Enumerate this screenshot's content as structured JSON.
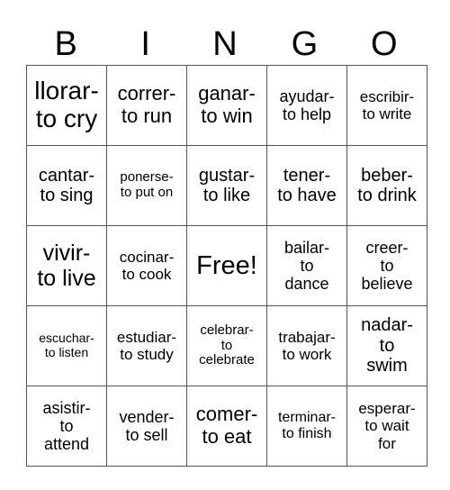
{
  "header": [
    "B",
    "I",
    "N",
    "G",
    "O"
  ],
  "rows": [
    [
      "llorar-\nto cry",
      "correr-\nto run",
      "ganar-\nto win",
      "ayudar-\nto help",
      "escribir-\nto write"
    ],
    [
      "cantar-\nto sing",
      "ponerse-\nto put on",
      "gustar-\nto like",
      "tener-\nto have",
      "beber-\nto drink"
    ],
    [
      "vivir-\nto live",
      "cocinar-\nto cook",
      "Free!",
      "bailar-\nto\ndance",
      "creer-\nto\nbelieve"
    ],
    [
      "escuchar-\nto listen",
      "estudiar-\nto study",
      "celebrar-\nto\ncelebrate",
      "trabajar-\nto work",
      "nadar-\nto\nswim"
    ],
    [
      "asistir-\nto\nattend",
      "vender-\nto sell",
      "comer-\nto eat",
      "terminar-\nto finish",
      "esperar-\nto wait\nfor"
    ]
  ]
}
